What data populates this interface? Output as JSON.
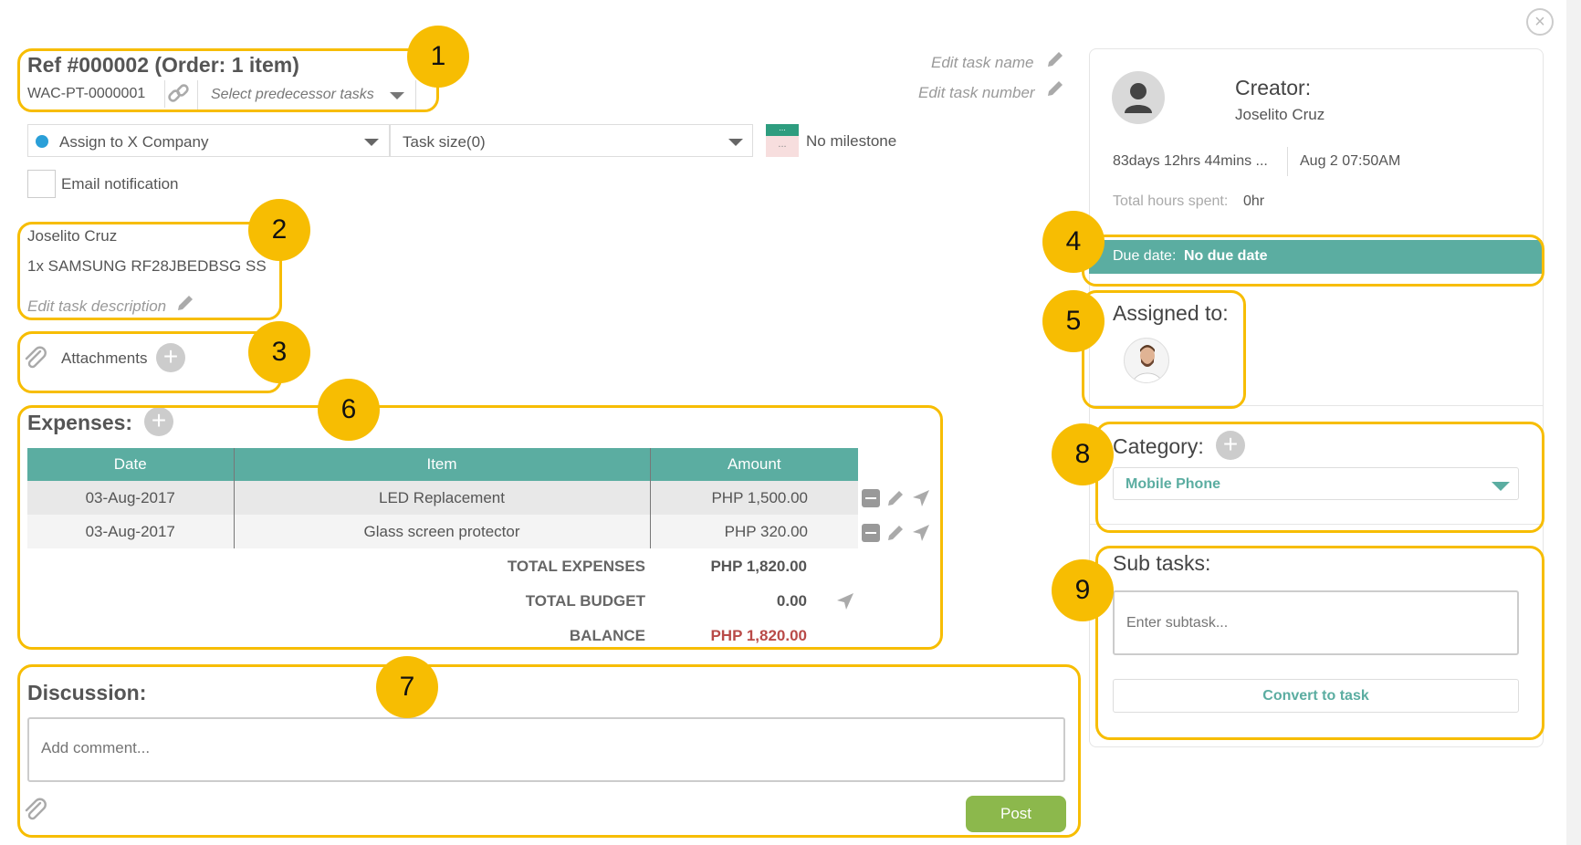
{
  "header": {
    "title": "Ref #000002 (Order: 1 item)",
    "task_number": "WAC-PT-0000001",
    "predecessor_placeholder": "Select predecessor tasks",
    "edit_name_label": "Edit task name",
    "edit_number_label": "Edit task number"
  },
  "assignment": {
    "assign_to": "Assign to X Company",
    "task_size": "Task size(0)",
    "milestone_icon_top": "...",
    "milestone_icon_bottom": "...",
    "milestone": "No milestone",
    "email_notification": "Email notification"
  },
  "description": {
    "customer": "Joselito Cruz",
    "item": "1x SAMSUNG RF28JBEDBSG SS",
    "edit_label": "Edit task description"
  },
  "attachments": {
    "label": "Attachments"
  },
  "expenses": {
    "title": "Expenses:",
    "columns": [
      "Date",
      "Item",
      "Amount"
    ],
    "rows": [
      {
        "date": "03-Aug-2017",
        "item": "LED Replacement",
        "amount": "PHP 1,500.00"
      },
      {
        "date": "03-Aug-2017",
        "item": "Glass screen protector",
        "amount": "PHP 320.00"
      }
    ],
    "total_expenses_label": "TOTAL EXPENSES",
    "total_expenses": "PHP 1,820.00",
    "total_budget_label": "TOTAL BUDGET",
    "total_budget": "0.00",
    "balance_label": "BALANCE",
    "balance": "PHP 1,820.00"
  },
  "discussion": {
    "title": "Discussion:",
    "comment_placeholder": "Add comment...",
    "post_label": "Post"
  },
  "sidebar": {
    "creator_label": "Creator:",
    "creator_name": "Joselito Cruz",
    "elapsed": "83days 12hrs 44mins ...",
    "created_at": "Aug 2 07:50AM",
    "hours_label": "Total hours spent:",
    "hours_value": "0hr",
    "due_label": "Due date:",
    "due_value": "No due date",
    "assigned_label": "Assigned to:",
    "category_label": "Category:",
    "category_value": "Mobile Phone",
    "subtasks_label": "Sub tasks:",
    "subtask_placeholder": "Enter subtask...",
    "convert_label": "Convert to task"
  },
  "callouts": [
    "1",
    "2",
    "3",
    "4",
    "5",
    "6",
    "7",
    "8",
    "9"
  ],
  "colors": {
    "accent": "#5bada1",
    "highlight": "#f7bd02",
    "post_button": "#8cb84c",
    "balance": "#b94a48",
    "assign_dot": "#2a9fd8"
  },
  "icons": [
    "close-icon",
    "link-icon",
    "pencil-icon",
    "paperclip-icon",
    "plus-icon",
    "minus-icon",
    "send-icon",
    "user-icon",
    "chevron-down-icon"
  ]
}
